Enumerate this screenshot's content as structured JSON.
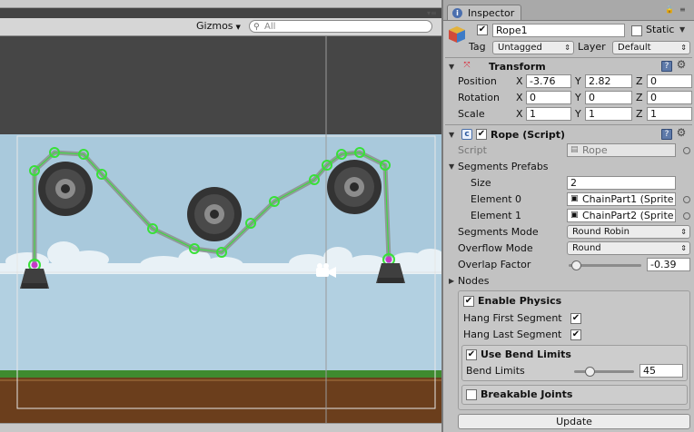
{
  "scene": {
    "gizmos_label": "Gizmos",
    "search_placeholder": "All"
  },
  "inspector": {
    "tab_label": "Inspector",
    "object": {
      "name": "Rope1",
      "active": true,
      "static_label": "Static",
      "static_checked": false,
      "tag_label": "Tag",
      "tag_value": "Untagged",
      "layer_label": "Layer",
      "layer_value": "Default"
    },
    "transform": {
      "title": "Transform",
      "rows": [
        {
          "label": "Position",
          "x": "-3.76",
          "y": "2.82",
          "z": "0"
        },
        {
          "label": "Rotation",
          "x": "0",
          "y": "0",
          "z": "0"
        },
        {
          "label": "Scale",
          "x": "1",
          "y": "1",
          "z": "1"
        }
      ],
      "axis_x": "X",
      "axis_y": "Y",
      "axis_z": "Z"
    },
    "rope": {
      "title": "Rope (Script)",
      "enabled": true,
      "script_label": "Script",
      "script_value": "Rope",
      "segments_prefabs_label": "Segments Prefabs",
      "size_label": "Size",
      "size_value": "2",
      "elements": [
        {
          "label": "Element 0",
          "value": "ChainPart1 (Sprite"
        },
        {
          "label": "Element 1",
          "value": "ChainPart2 (Sprite"
        }
      ],
      "segments_mode_label": "Segments Mode",
      "segments_mode_value": "Round Robin",
      "overflow_mode_label": "Overflow Mode",
      "overflow_mode_value": "Round",
      "overlap_factor_label": "Overlap Factor",
      "overlap_factor_value": "-0.39",
      "overlap_factor_slider": 0.1,
      "nodes_label": "Nodes",
      "enable_physics_label": "Enable Physics",
      "enable_physics": true,
      "hang_first_label": "Hang First Segment",
      "hang_first": true,
      "hang_last_label": "Hang Last Segment",
      "hang_last": true,
      "use_bend_limits_label": "Use Bend Limits",
      "use_bend_limits": true,
      "bend_limits_label": "Bend Limits",
      "bend_limits_value": "45",
      "bend_limits_slider": 0.25,
      "breakable_joints_label": "Breakable Joints",
      "breakable_joints": false,
      "update_button": "Update"
    }
  },
  "colors": {
    "sky": "#a9c9dc",
    "grass": "#3f8a2f",
    "soil": "#6b3e1c",
    "chain_selection": "#38e038",
    "node_magenta": "#c838c8"
  }
}
